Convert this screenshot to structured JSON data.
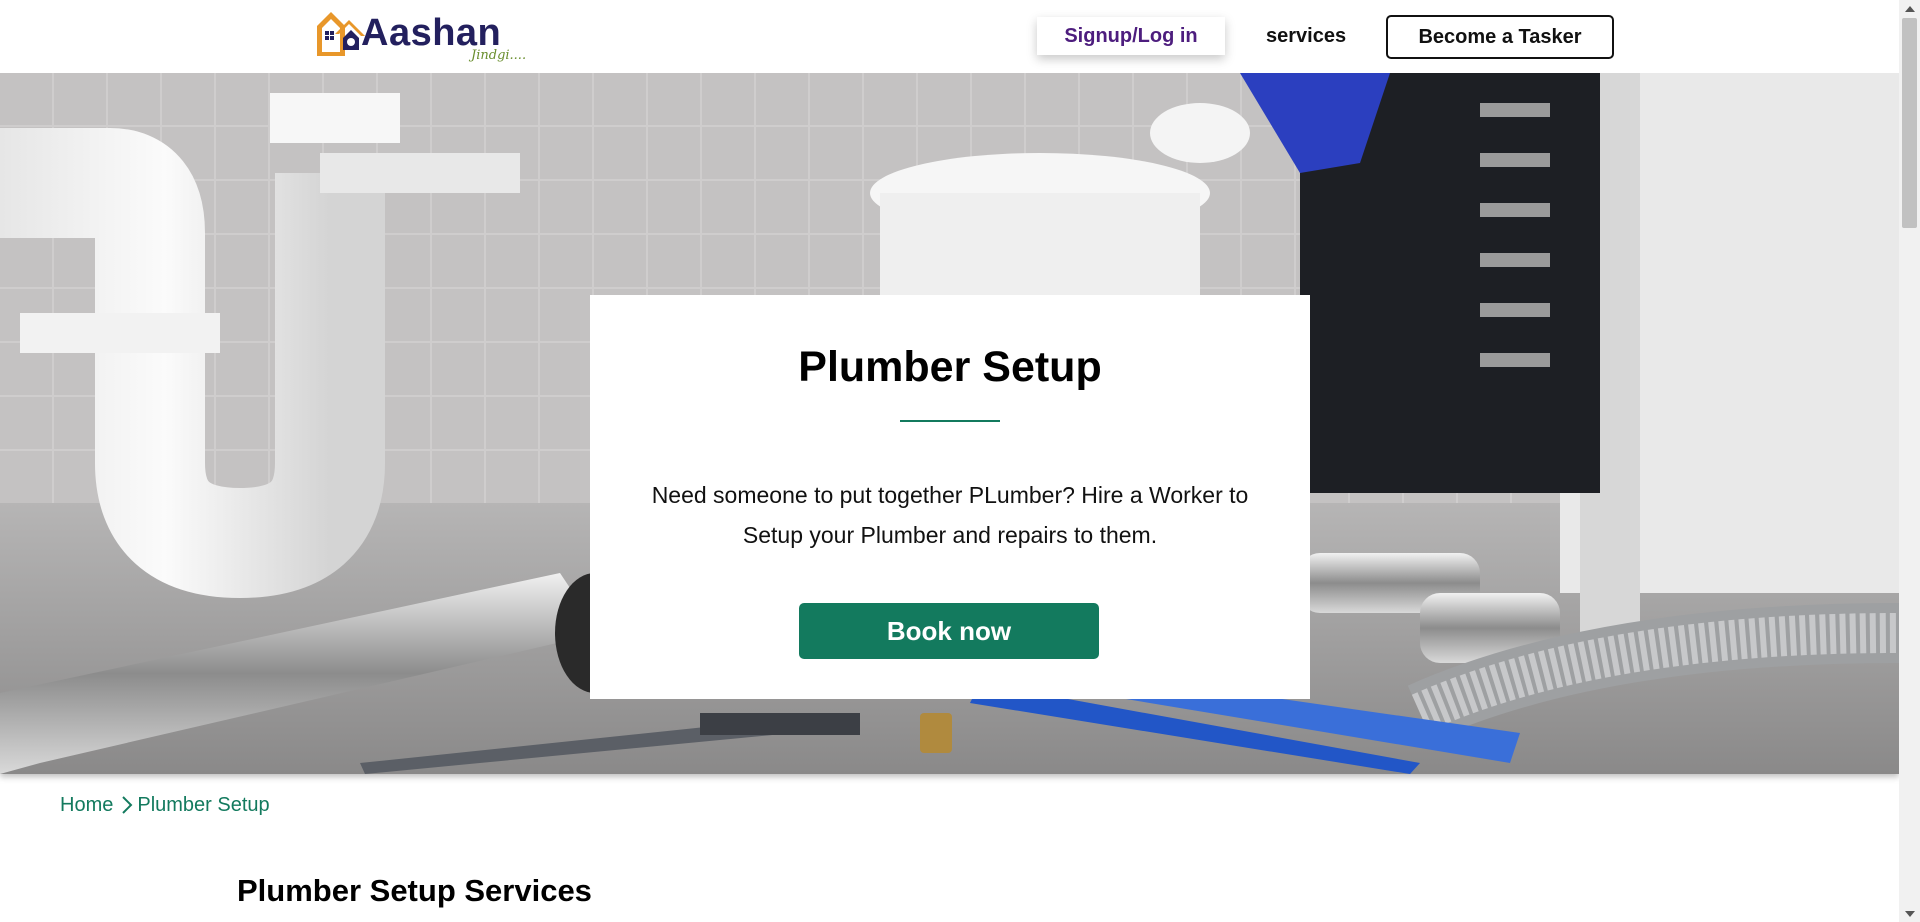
{
  "header": {
    "logo_word": "Aashan",
    "logo_tagline": "Jindgi....",
    "signup_label": "Signup/Log in",
    "services_label": "services",
    "tasker_label": "Become a Tasker"
  },
  "hero": {
    "title": "Plumber Setup",
    "description": "Need someone to put together PLumber? Hire a Worker to Setup your Plumber and repairs to them.",
    "book_label": "Book now"
  },
  "breadcrumb": {
    "home": "Home",
    "current": "Plumber Setup"
  },
  "section": {
    "title": "Plumber Setup Services"
  },
  "colors": {
    "accent": "#137a5e",
    "signup_text": "#4d1d7e",
    "logo_navy": "#23205e",
    "logo_orange": "#e8972a"
  }
}
